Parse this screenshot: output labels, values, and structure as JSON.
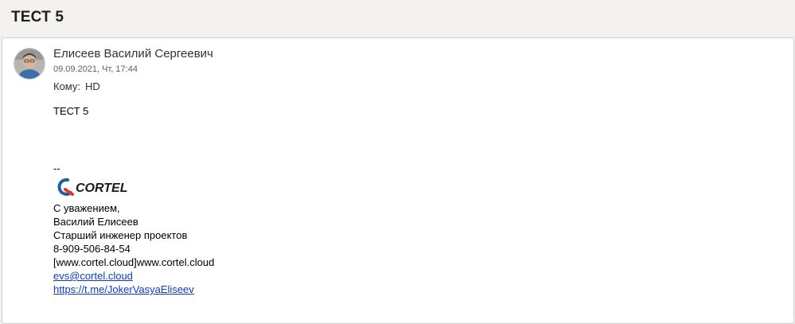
{
  "subject": "ТЕСТ 5",
  "message": {
    "sender_name": "Елисеев Василий Сергеевич",
    "datetime": "09.09.2021, Чт, 17:44",
    "to_label": "Кому:",
    "to_value": "HD",
    "body_text": "ТЕСТ 5",
    "signature_separator": "--",
    "logo_text": "CORTEL",
    "signature_lines": {
      "greeting": "С уважением,",
      "name": "Василий Елисеев",
      "position": "Старший инженер проектов",
      "phone": "8-909-506-84-54",
      "website": "[www.cortel.cloud]www.cortel.cloud",
      "email": "evs@cortel.cloud",
      "telegram": "https://t.me/JokerVasyaEliseev"
    },
    "colors": {
      "logo_blue": "#1f5ea8",
      "logo_red": "#e03a2f",
      "link": "#0b3dc4"
    }
  }
}
